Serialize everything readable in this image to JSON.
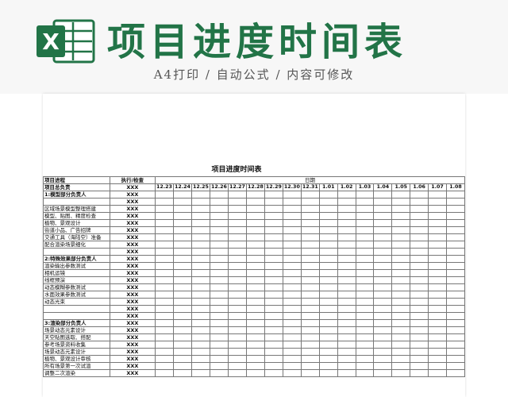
{
  "header": {
    "title": "项目进度时间表",
    "subtitle": "A4打印 / 自动公式 / 内容可修改",
    "logo_icon": "excel-icon",
    "brand_color": "#227447",
    "logo_letter": "X"
  },
  "sheet": {
    "title": "项目进度时间表",
    "col_headers": {
      "progress": "项目进程",
      "exec": "执行/检查",
      "date": "日期"
    },
    "lead_row": {
      "label": "项目总负责",
      "value": "XXX"
    },
    "dates": [
      "12.23",
      "12.24",
      "12.25",
      "12.26",
      "12.27",
      "12.28",
      "12.29",
      "12.30",
      "12.31",
      "1.01",
      "1.02",
      "1.03",
      "1.04",
      "1.05",
      "1.06",
      "1.07",
      "1.08"
    ],
    "rows": [
      {
        "label": "1:模型部分负责人",
        "exec": "XXX",
        "section": true
      },
      {
        "label": "",
        "exec": "XXX"
      },
      {
        "label": "区域场景模型整理搭建",
        "exec": "XXX"
      },
      {
        "label": "模型、贴图、精度检查",
        "exec": "XXX"
      },
      {
        "label": "植物、景观设计",
        "exec": "XXX"
      },
      {
        "label": "街道小品、广告招牌",
        "exec": "XXX"
      },
      {
        "label": "交通工具（海陆空）准备",
        "exec": "XXX"
      },
      {
        "label": "配合渲染场景细化",
        "exec": "XXX"
      },
      {
        "label": "",
        "exec": "XXX"
      },
      {
        "label": "2:特殊效果部分负责人",
        "exec": "XXX",
        "section": true
      },
      {
        "label": "渲染输出参数测试",
        "exec": "XXX"
      },
      {
        "label": "相机运镜",
        "exec": "XXX"
      },
      {
        "label": "线框预演",
        "exec": "XXX"
      },
      {
        "label": "动态模糊参数测试",
        "exec": "XXX"
      },
      {
        "label": "水面效果参数测试",
        "exec": "XXX"
      },
      {
        "label": "动态光束",
        "exec": "XXX"
      },
      {
        "label": "",
        "exec": "XXX"
      },
      {
        "label": "",
        "exec": "XXX"
      },
      {
        "label": "3:渲染部分负责人",
        "exec": "XXX",
        "section": true
      },
      {
        "label": "场景动态元素设计",
        "exec": "XXX"
      },
      {
        "label": "天空贴图选取、搭配",
        "exec": "XXX"
      },
      {
        "label": "参考场景资料收集",
        "exec": "XXX"
      },
      {
        "label": "场景动态元素设计",
        "exec": "XXX"
      },
      {
        "label": "植物、景观设计审核",
        "exec": "XXX"
      },
      {
        "label": "所有场景第一次试渲",
        "exec": "XXX"
      },
      {
        "label": "调整二次渲染",
        "exec": "XXX"
      }
    ]
  }
}
